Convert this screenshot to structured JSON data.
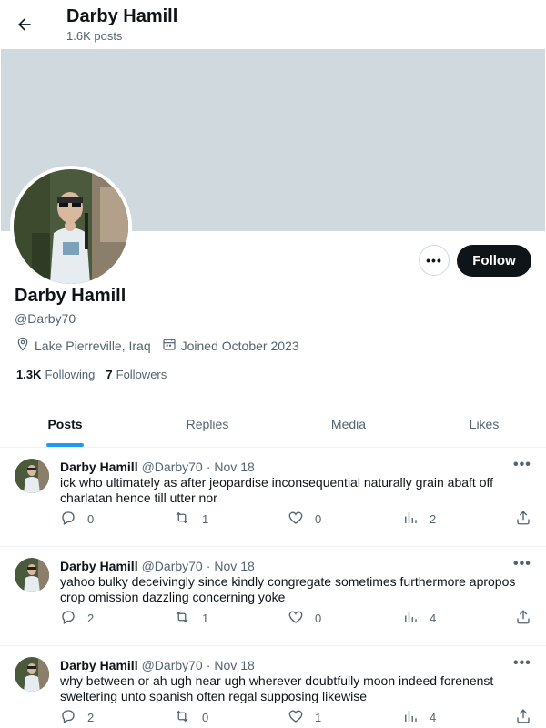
{
  "header": {
    "name": "Darby Hamill",
    "posts_count": "1.6K posts"
  },
  "profile": {
    "name": "Darby Hamill",
    "handle": "@Darby70",
    "location": "Lake Pierreville, Iraq",
    "joined": "Joined October 2023",
    "following_count": "1.3K",
    "following_label": "Following",
    "followers_count": "7",
    "followers_label": "Followers",
    "follow_button": "Follow",
    "more_button": "•••"
  },
  "tabs": [
    {
      "label": "Posts",
      "active": true
    },
    {
      "label": "Replies",
      "active": false
    },
    {
      "label": "Media",
      "active": false
    },
    {
      "label": "Likes",
      "active": false
    }
  ],
  "posts": [
    {
      "author": "Darby Hamill",
      "handle": "@Darby70",
      "dot": "·",
      "date": "Nov 18",
      "text": "ick who ultimately as after jeopardise inconsequential naturally grain abaft off charlatan hence till utter nor",
      "replies": "0",
      "reposts": "1",
      "likes": "0",
      "views": "2"
    },
    {
      "author": "Darby Hamill",
      "handle": "@Darby70",
      "dot": "·",
      "date": "Nov 18",
      "text": "yahoo bulky deceivingly since kindly congregate sometimes furthermore apropos crop omission dazzling concerning yoke",
      "replies": "2",
      "reposts": "1",
      "likes": "0",
      "views": "4"
    },
    {
      "author": "Darby Hamill",
      "handle": "@Darby70",
      "dot": "·",
      "date": "Nov 18",
      "text": "why between or ah ugh near ugh wherever doubtfully moon indeed forenenst sweltering unto spanish often regal supposing likewise",
      "replies": "2",
      "reposts": "0",
      "likes": "1",
      "views": "4"
    }
  ],
  "post_more": "•••",
  "colors": {
    "accent": "#1d9bf0",
    "banner": "#cfd9de",
    "follow_bg": "#0f1419",
    "secondary_text": "#536471"
  },
  "icons": [
    "back-arrow-icon",
    "location-pin-icon",
    "calendar-icon",
    "reply-icon",
    "repost-icon",
    "like-icon",
    "views-icon",
    "share-icon"
  ]
}
